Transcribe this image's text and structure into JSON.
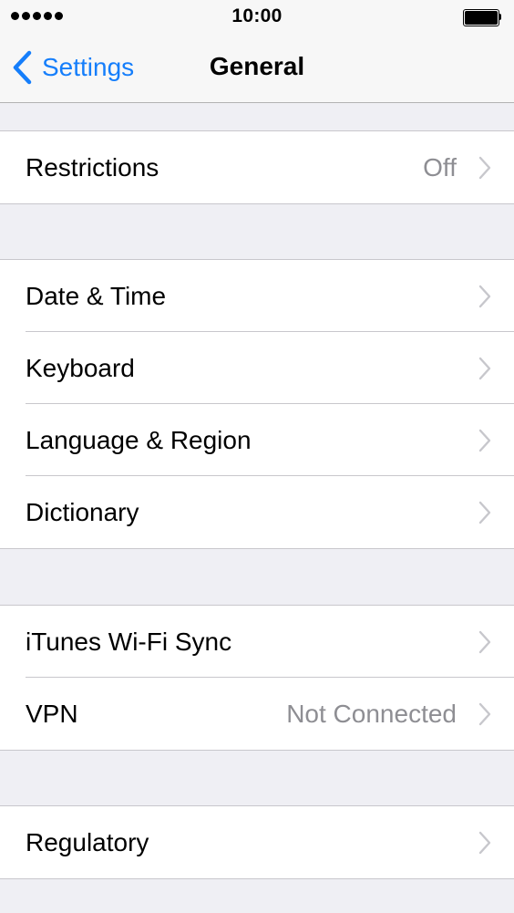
{
  "status_bar": {
    "time": "10:00",
    "signal_bars": 5,
    "battery_level": 1.0,
    "icons": [
      "signal-dots-icon",
      "battery-icon"
    ]
  },
  "nav_bar": {
    "back_label": "Settings",
    "title": "General",
    "back_icon": "chevron-left-icon",
    "accent_color": "#157efb"
  },
  "groups": [
    {
      "rows": [
        {
          "label": "Restrictions",
          "value": "Off"
        }
      ]
    },
    {
      "rows": [
        {
          "label": "Date & Time",
          "value": ""
        },
        {
          "label": "Keyboard",
          "value": ""
        },
        {
          "label": "Language & Region",
          "value": ""
        },
        {
          "label": "Dictionary",
          "value": ""
        }
      ]
    },
    {
      "rows": [
        {
          "label": "iTunes Wi-Fi Sync",
          "value": ""
        },
        {
          "label": "VPN",
          "value": "Not Connected"
        }
      ]
    },
    {
      "rows": [
        {
          "label": "Regulatory",
          "value": ""
        }
      ]
    }
  ],
  "colors": {
    "background": "#efeff4",
    "cell": "#ffffff",
    "separator": "#c8c7cc",
    "secondary_text": "#8e8e93",
    "chevron": "#c7c7cc"
  }
}
